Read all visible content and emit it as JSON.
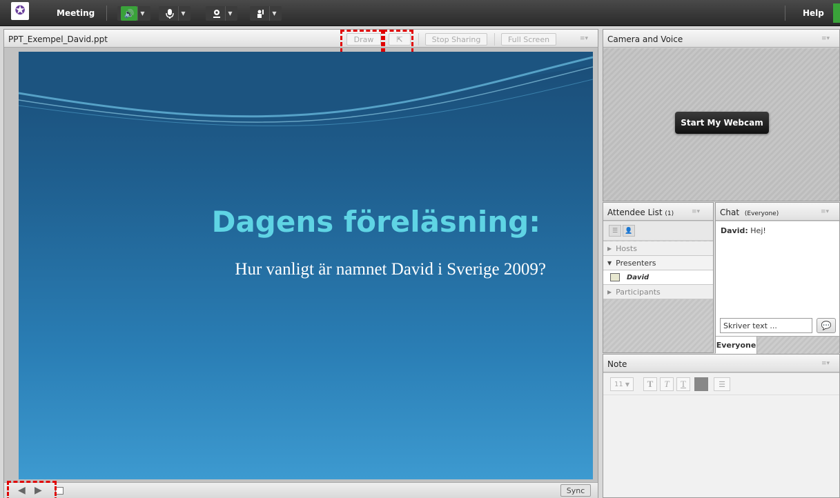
{
  "menubar": {
    "meeting_label": "Meeting",
    "help_label": "Help",
    "accent_green": "#3aa23a",
    "icons": [
      "speaker-icon",
      "microphone-icon",
      "webcam-icon",
      "raise-hand-icon"
    ]
  },
  "share_pod": {
    "title": "PPT_Exempel_David.ppt",
    "draw_label": "Draw",
    "stop_sharing_label": "Stop Sharing",
    "full_screen_label": "Full Screen",
    "sync_label": "Sync",
    "slide": {
      "title": "Dagens föreläsning:",
      "subtitle": "Hur vanligt är namnet David i Sverige 2009?"
    },
    "highlight_color": "#e00000"
  },
  "camera_pod": {
    "title": "Camera and Voice",
    "start_webcam_label": "Start My Webcam"
  },
  "attendee_pod": {
    "title": "Attendee List",
    "count": "(1)",
    "groups": [
      {
        "label": "Hosts",
        "expanded": false
      },
      {
        "label": "Presenters",
        "expanded": true
      },
      {
        "label": "Participants",
        "expanded": false
      }
    ],
    "presenter_name": "David"
  },
  "chat_pod": {
    "title": "Chat",
    "scope": "(Everyone)",
    "messages": [
      {
        "sender": "David:",
        "text": "Hej!"
      }
    ],
    "input_value": "Skriver text ...",
    "tab_label": "Everyone"
  },
  "note_pod": {
    "title": "Note",
    "font_size": "11"
  }
}
